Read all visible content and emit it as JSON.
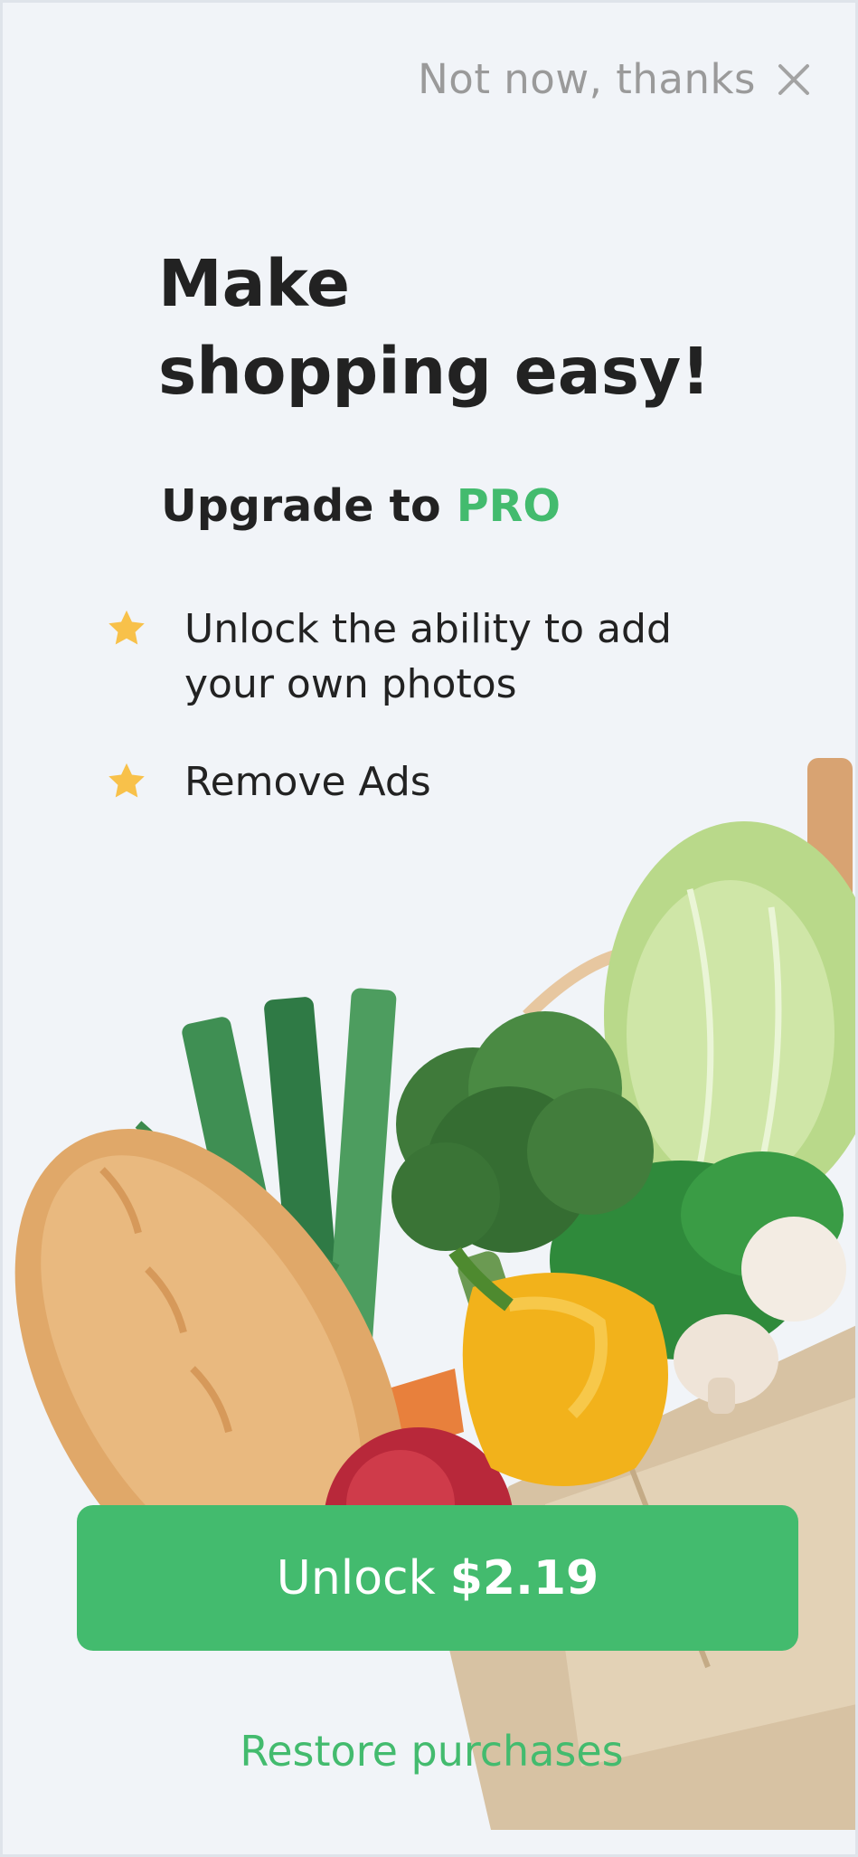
{
  "dismiss": {
    "label": "Not now, thanks",
    "icon": "close-icon"
  },
  "headline": {
    "line1": "Make",
    "line2": "shopping easy!"
  },
  "upgrade": {
    "prefix": "Upgrade to ",
    "highlight": "PRO"
  },
  "features": [
    {
      "line1": "Unlock the ability to add",
      "line2": "your own photos",
      "icon": "star-icon"
    },
    {
      "line1": "Remove Ads",
      "icon": "star-icon"
    }
  ],
  "cta": {
    "label": "Unlock",
    "price": "$2.19"
  },
  "restore": {
    "label": "Restore purchases"
  },
  "colors": {
    "accent": "#43bb6e",
    "star": "#f8c14a",
    "background": "#f1f4f8",
    "text": "#222222",
    "muted": "#9a9a9a"
  }
}
